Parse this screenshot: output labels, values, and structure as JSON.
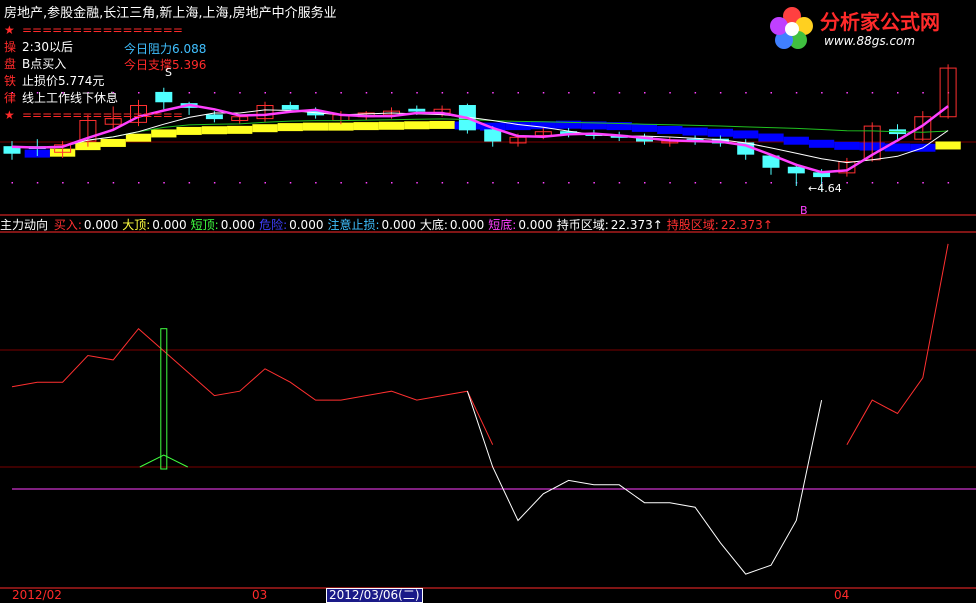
{
  "header": {
    "title": "房地产,参股金融,长江三角,新上海,上海,房地产中介服务业"
  },
  "logo": {
    "title": "分析家公式网",
    "url": "www.88gs.com"
  },
  "rules": [
    {
      "tag": "★",
      "text": "================",
      "red": true
    },
    {
      "tag": "操",
      "text": "2:30以后",
      "red": false
    },
    {
      "tag": "盘",
      "text": "B点买入",
      "red": false
    },
    {
      "tag": "铁",
      "text": "止损价5.774元",
      "red": false
    },
    {
      "tag": "律",
      "text": "线上工作线下休息",
      "red": false
    },
    {
      "tag": "★",
      "text": "================",
      "red": true
    }
  ],
  "levels": {
    "resistance": "今日阻力6.088",
    "support": "今日支撑5.396"
  },
  "markers": {
    "sell": "S",
    "buy": "B",
    "low_price": "←4.64"
  },
  "indicator": {
    "name": "主力动向",
    "items": [
      {
        "label": "买入:",
        "value": "0.000",
        "color": "#ff3030"
      },
      {
        "label": "大顶:",
        "value": "0.000",
        "color": "#ffff40"
      },
      {
        "label": "短顶:",
        "value": "0.000",
        "color": "#40ff40"
      },
      {
        "label": "危险:",
        "value": "0.000",
        "color": "#4040ff"
      },
      {
        "label": "注意止损:",
        "value": "0.000",
        "color": "#40c0ff"
      },
      {
        "label": "大底:",
        "value": "0.000",
        "color": "#ffffff"
      },
      {
        "label": "短底:",
        "value": "0.000",
        "color": "#ff40ff"
      },
      {
        "label": "持币区域:",
        "value": "22.373↑",
        "color": "#ffffff"
      },
      {
        "label": "持股区域:",
        "value": "22.373↑",
        "color": "#ff3030"
      }
    ]
  },
  "dates": {
    "d1": "2012/02",
    "d2": "03",
    "selected": "2012/03/06(二)",
    "d3": "04"
  },
  "chart_data": {
    "type": "line",
    "candles": [
      {
        "o": 5.05,
        "c": 5.12,
        "h": 5.18,
        "l": 4.98,
        "up": false
      },
      {
        "o": 5.12,
        "c": 5.1,
        "h": 5.2,
        "l": 5.02,
        "up": false
      },
      {
        "o": 5.06,
        "c": 5.14,
        "h": 5.18,
        "l": 5.0,
        "up": true
      },
      {
        "o": 5.18,
        "c": 5.4,
        "h": 5.46,
        "l": 5.12,
        "up": true
      },
      {
        "o": 5.42,
        "c": 5.36,
        "h": 5.55,
        "l": 5.3,
        "up": true
      },
      {
        "o": 5.38,
        "c": 5.56,
        "h": 5.62,
        "l": 5.34,
        "up": true
      },
      {
        "o": 5.7,
        "c": 5.6,
        "h": 5.75,
        "l": 5.52,
        "up": false
      },
      {
        "o": 5.58,
        "c": 5.54,
        "h": 5.6,
        "l": 5.46,
        "up": false
      },
      {
        "o": 5.46,
        "c": 5.42,
        "h": 5.5,
        "l": 5.38,
        "up": false
      },
      {
        "o": 5.44,
        "c": 5.4,
        "h": 5.46,
        "l": 5.36,
        "up": true
      },
      {
        "o": 5.42,
        "c": 5.56,
        "h": 5.6,
        "l": 5.38,
        "up": true
      },
      {
        "o": 5.56,
        "c": 5.52,
        "h": 5.6,
        "l": 5.48,
        "up": false
      },
      {
        "o": 5.5,
        "c": 5.46,
        "h": 5.54,
        "l": 5.42,
        "up": false
      },
      {
        "o": 5.46,
        "c": 5.4,
        "h": 5.5,
        "l": 5.36,
        "up": true
      },
      {
        "o": 5.44,
        "c": 5.48,
        "h": 5.5,
        "l": 5.4,
        "up": true
      },
      {
        "o": 5.5,
        "c": 5.46,
        "h": 5.54,
        "l": 5.42,
        "up": true
      },
      {
        "o": 5.52,
        "c": 5.5,
        "h": 5.56,
        "l": 5.46,
        "up": false
      },
      {
        "o": 5.52,
        "c": 5.48,
        "h": 5.56,
        "l": 5.44,
        "up": true
      },
      {
        "o": 5.56,
        "c": 5.3,
        "h": 5.58,
        "l": 5.26,
        "up": false
      },
      {
        "o": 5.3,
        "c": 5.18,
        "h": 5.34,
        "l": 5.12,
        "up": false
      },
      {
        "o": 5.16,
        "c": 5.22,
        "h": 5.26,
        "l": 5.12,
        "up": true
      },
      {
        "o": 5.24,
        "c": 5.28,
        "h": 5.32,
        "l": 5.2,
        "up": true
      },
      {
        "o": 5.28,
        "c": 5.26,
        "h": 5.32,
        "l": 5.22,
        "up": false
      },
      {
        "o": 5.26,
        "c": 5.24,
        "h": 5.3,
        "l": 5.2,
        "up": false
      },
      {
        "o": 5.24,
        "c": 5.22,
        "h": 5.28,
        "l": 5.18,
        "up": false
      },
      {
        "o": 5.22,
        "c": 5.18,
        "h": 5.26,
        "l": 5.14,
        "up": false
      },
      {
        "o": 5.18,
        "c": 5.16,
        "h": 5.22,
        "l": 5.12,
        "up": true
      },
      {
        "o": 5.18,
        "c": 5.2,
        "h": 5.24,
        "l": 5.14,
        "up": false
      },
      {
        "o": 5.2,
        "c": 5.16,
        "h": 5.24,
        "l": 5.12,
        "up": false
      },
      {
        "o": 5.16,
        "c": 5.04,
        "h": 5.2,
        "l": 4.98,
        "up": false
      },
      {
        "o": 5.02,
        "c": 4.9,
        "h": 5.04,
        "l": 4.82,
        "up": false
      },
      {
        "o": 4.9,
        "c": 4.84,
        "h": 4.94,
        "l": 4.7,
        "up": false
      },
      {
        "o": 4.84,
        "c": 4.8,
        "h": 4.88,
        "l": 4.64,
        "up": false
      },
      {
        "o": 4.84,
        "c": 4.96,
        "h": 5.0,
        "l": 4.8,
        "up": true
      },
      {
        "o": 4.98,
        "c": 5.34,
        "h": 5.38,
        "l": 4.96,
        "up": true
      },
      {
        "o": 5.3,
        "c": 5.26,
        "h": 5.36,
        "l": 5.2,
        "up": false
      },
      {
        "o": 5.2,
        "c": 5.44,
        "h": 5.5,
        "l": 5.18,
        "up": true
      },
      {
        "o": 5.44,
        "c": 5.96,
        "h": 6.0,
        "l": 5.42,
        "up": true
      }
    ],
    "osc_red": [
      18,
      19,
      19,
      25,
      24,
      31,
      26,
      21,
      16,
      17,
      22,
      19,
      15,
      15,
      16,
      17,
      15,
      16,
      17,
      5,
      null,
      null,
      null,
      null,
      null,
      null,
      null,
      null,
      null,
      null,
      null,
      null,
      null,
      5,
      15,
      12,
      20,
      50
    ],
    "osc_white": [
      null,
      null,
      null,
      null,
      null,
      null,
      null,
      null,
      null,
      null,
      null,
      null,
      null,
      null,
      null,
      null,
      null,
      null,
      17,
      0,
      -12,
      -6,
      -3,
      -4,
      -4,
      -8,
      -8,
      -9,
      -17,
      -24,
      -22,
      -12,
      15,
      null,
      null,
      null,
      null,
      null
    ]
  }
}
